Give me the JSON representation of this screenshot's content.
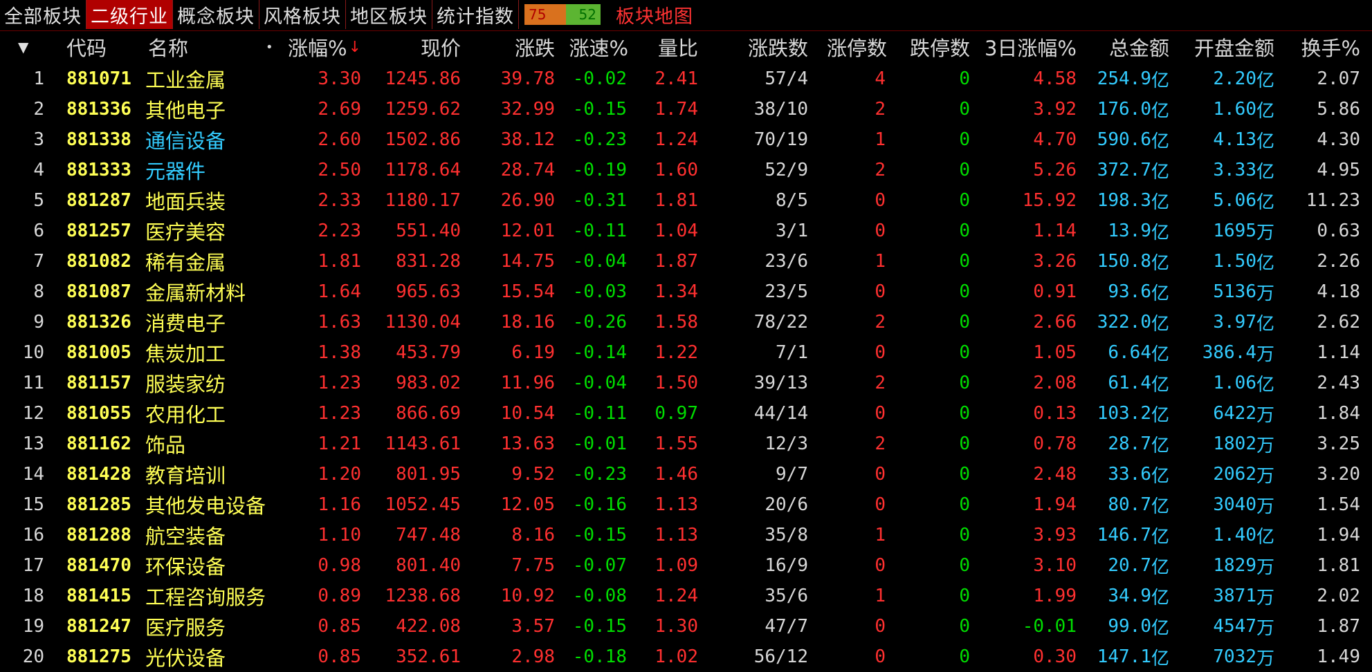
{
  "tabs": [
    {
      "label": "全部板块",
      "active": false
    },
    {
      "label": "二级行业",
      "active": true
    },
    {
      "label": "概念板块",
      "active": false
    },
    {
      "label": "风格板块",
      "active": false
    },
    {
      "label": "地区板块",
      "active": false
    },
    {
      "label": "统计指数",
      "active": false
    }
  ],
  "ratio": {
    "up": "75",
    "down": "52"
  },
  "map_link": "板块地图",
  "header": {
    "dropdown_icon": "▼",
    "code": "代码",
    "name": "名称",
    "name_dot": "•",
    "pct": "涨幅%",
    "price": "现价",
    "change": "涨跌",
    "speed": "涨速%",
    "volume_ratio": "量比",
    "up_down": "涨跌数",
    "limit_up": "涨停数",
    "limit_down": "跌停数",
    "pct_3d": "3日涨幅%",
    "total_amount": "总金额",
    "open_amount": "开盘金额",
    "turnover": "换手%"
  },
  "colors": {
    "up": "#ff3030",
    "down": "#00dd00",
    "code": "#ffff55",
    "amount": "#33ccff",
    "active_tab": "#b00000"
  },
  "rows": [
    {
      "n": "1",
      "code": "881071",
      "name": "工业金属",
      "name_blue": false,
      "pct": "3.30",
      "price": "1245.86",
      "chg": "39.78",
      "speed": "-0.02",
      "vr": "2.41",
      "vr_down": false,
      "ud": "57/4",
      "lu": "4",
      "ld": "0",
      "d3": "4.58",
      "d3_down": false,
      "tot": "254.9",
      "tot_u": "亿",
      "open": "2.20",
      "open_u": "亿",
      "turn": "2.07"
    },
    {
      "n": "2",
      "code": "881336",
      "name": "其他电子",
      "name_blue": false,
      "pct": "2.69",
      "price": "1259.62",
      "chg": "32.99",
      "speed": "-0.15",
      "vr": "1.74",
      "vr_down": false,
      "ud": "38/10",
      "lu": "2",
      "ld": "0",
      "d3": "3.92",
      "d3_down": false,
      "tot": "176.0",
      "tot_u": "亿",
      "open": "1.60",
      "open_u": "亿",
      "turn": "5.86"
    },
    {
      "n": "3",
      "code": "881338",
      "name": "通信设备",
      "name_blue": true,
      "pct": "2.60",
      "price": "1502.86",
      "chg": "38.12",
      "speed": "-0.23",
      "vr": "1.24",
      "vr_down": false,
      "ud": "70/19",
      "lu": "1",
      "ld": "0",
      "d3": "4.70",
      "d3_down": false,
      "tot": "590.6",
      "tot_u": "亿",
      "open": "4.13",
      "open_u": "亿",
      "turn": "4.30"
    },
    {
      "n": "4",
      "code": "881333",
      "name": "元器件",
      "name_blue": true,
      "pct": "2.50",
      "price": "1178.64",
      "chg": "28.74",
      "speed": "-0.19",
      "vr": "1.60",
      "vr_down": false,
      "ud": "52/9",
      "lu": "2",
      "ld": "0",
      "d3": "5.26",
      "d3_down": false,
      "tot": "372.7",
      "tot_u": "亿",
      "open": "3.33",
      "open_u": "亿",
      "turn": "4.95"
    },
    {
      "n": "5",
      "code": "881287",
      "name": "地面兵装",
      "name_blue": false,
      "pct": "2.33",
      "price": "1180.17",
      "chg": "26.90",
      "speed": "-0.31",
      "vr": "1.81",
      "vr_down": false,
      "ud": "8/5",
      "lu": "0",
      "ld": "0",
      "d3": "15.92",
      "d3_down": false,
      "tot": "198.3",
      "tot_u": "亿",
      "open": "5.06",
      "open_u": "亿",
      "turn": "11.23"
    },
    {
      "n": "6",
      "code": "881257",
      "name": "医疗美容",
      "name_blue": false,
      "pct": "2.23",
      "price": "551.40",
      "chg": "12.01",
      "speed": "-0.11",
      "vr": "1.04",
      "vr_down": false,
      "ud": "3/1",
      "lu": "0",
      "ld": "0",
      "d3": "1.14",
      "d3_down": false,
      "tot": "13.9",
      "tot_u": "亿",
      "open": "1695",
      "open_u": "万",
      "turn": "0.63"
    },
    {
      "n": "7",
      "code": "881082",
      "name": "稀有金属",
      "name_blue": false,
      "pct": "1.81",
      "price": "831.28",
      "chg": "14.75",
      "speed": "-0.04",
      "vr": "1.87",
      "vr_down": false,
      "ud": "23/6",
      "lu": "1",
      "ld": "0",
      "d3": "3.26",
      "d3_down": false,
      "tot": "150.8",
      "tot_u": "亿",
      "open": "1.50",
      "open_u": "亿",
      "turn": "2.26"
    },
    {
      "n": "8",
      "code": "881087",
      "name": "金属新材料",
      "name_blue": false,
      "pct": "1.64",
      "price": "965.63",
      "chg": "15.54",
      "speed": "-0.03",
      "vr": "1.34",
      "vr_down": false,
      "ud": "23/5",
      "lu": "0",
      "ld": "0",
      "d3": "0.91",
      "d3_down": false,
      "tot": "93.6",
      "tot_u": "亿",
      "open": "5136",
      "open_u": "万",
      "turn": "4.18"
    },
    {
      "n": "9",
      "code": "881326",
      "name": "消费电子",
      "name_blue": false,
      "pct": "1.63",
      "price": "1130.04",
      "chg": "18.16",
      "speed": "-0.26",
      "vr": "1.58",
      "vr_down": false,
      "ud": "78/22",
      "lu": "2",
      "ld": "0",
      "d3": "2.66",
      "d3_down": false,
      "tot": "322.0",
      "tot_u": "亿",
      "open": "3.97",
      "open_u": "亿",
      "turn": "2.62"
    },
    {
      "n": "10",
      "code": "881005",
      "name": "焦炭加工",
      "name_blue": false,
      "pct": "1.38",
      "price": "453.79",
      "chg": "6.19",
      "speed": "-0.14",
      "vr": "1.22",
      "vr_down": false,
      "ud": "7/1",
      "lu": "0",
      "ld": "0",
      "d3": "1.05",
      "d3_down": false,
      "tot": "6.64",
      "tot_u": "亿",
      "open": "386.4",
      "open_u": "万",
      "turn": "1.14"
    },
    {
      "n": "11",
      "code": "881157",
      "name": "服装家纺",
      "name_blue": false,
      "pct": "1.23",
      "price": "983.02",
      "chg": "11.96",
      "speed": "-0.04",
      "vr": "1.50",
      "vr_down": false,
      "ud": "39/13",
      "lu": "2",
      "ld": "0",
      "d3": "2.08",
      "d3_down": false,
      "tot": "61.4",
      "tot_u": "亿",
      "open": "1.06",
      "open_u": "亿",
      "turn": "2.43"
    },
    {
      "n": "12",
      "code": "881055",
      "name": "农用化工",
      "name_blue": false,
      "pct": "1.23",
      "price": "866.69",
      "chg": "10.54",
      "speed": "-0.11",
      "vr": "0.97",
      "vr_down": true,
      "ud": "44/14",
      "lu": "0",
      "ld": "0",
      "d3": "0.13",
      "d3_down": false,
      "tot": "103.2",
      "tot_u": "亿",
      "open": "6422",
      "open_u": "万",
      "turn": "1.84"
    },
    {
      "n": "13",
      "code": "881162",
      "name": "饰品",
      "name_blue": false,
      "pct": "1.21",
      "price": "1143.61",
      "chg": "13.63",
      "speed": "-0.01",
      "vr": "1.55",
      "vr_down": false,
      "ud": "12/3",
      "lu": "2",
      "ld": "0",
      "d3": "0.78",
      "d3_down": false,
      "tot": "28.7",
      "tot_u": "亿",
      "open": "1802",
      "open_u": "万",
      "turn": "3.25"
    },
    {
      "n": "14",
      "code": "881428",
      "name": "教育培训",
      "name_blue": false,
      "pct": "1.20",
      "price": "801.95",
      "chg": "9.52",
      "speed": "-0.23",
      "vr": "1.46",
      "vr_down": false,
      "ud": "9/7",
      "lu": "0",
      "ld": "0",
      "d3": "2.48",
      "d3_down": false,
      "tot": "33.6",
      "tot_u": "亿",
      "open": "2062",
      "open_u": "万",
      "turn": "3.20"
    },
    {
      "n": "15",
      "code": "881285",
      "name": "其他发电设备",
      "name_blue": false,
      "pct": "1.16",
      "price": "1052.45",
      "chg": "12.05",
      "speed": "-0.16",
      "vr": "1.13",
      "vr_down": false,
      "ud": "20/6",
      "lu": "0",
      "ld": "0",
      "d3": "1.94",
      "d3_down": false,
      "tot": "80.7",
      "tot_u": "亿",
      "open": "3040",
      "open_u": "万",
      "turn": "1.54"
    },
    {
      "n": "16",
      "code": "881288",
      "name": "航空装备",
      "name_blue": false,
      "pct": "1.10",
      "price": "747.48",
      "chg": "8.16",
      "speed": "-0.15",
      "vr": "1.13",
      "vr_down": false,
      "ud": "35/8",
      "lu": "1",
      "ld": "0",
      "d3": "3.93",
      "d3_down": false,
      "tot": "146.7",
      "tot_u": "亿",
      "open": "1.40",
      "open_u": "亿",
      "turn": "1.94"
    },
    {
      "n": "17",
      "code": "881470",
      "name": "环保设备",
      "name_blue": false,
      "pct": "0.98",
      "price": "801.40",
      "chg": "7.75",
      "speed": "-0.07",
      "vr": "1.09",
      "vr_down": false,
      "ud": "16/9",
      "lu": "0",
      "ld": "0",
      "d3": "3.10",
      "d3_down": false,
      "tot": "20.7",
      "tot_u": "亿",
      "open": "1829",
      "open_u": "万",
      "turn": "1.81"
    },
    {
      "n": "18",
      "code": "881415",
      "name": "工程咨询服务",
      "name_blue": false,
      "pct": "0.89",
      "price": "1238.68",
      "chg": "10.92",
      "speed": "-0.08",
      "vr": "1.24",
      "vr_down": false,
      "ud": "35/6",
      "lu": "1",
      "ld": "0",
      "d3": "1.99",
      "d3_down": false,
      "tot": "34.9",
      "tot_u": "亿",
      "open": "3871",
      "open_u": "万",
      "turn": "2.02"
    },
    {
      "n": "19",
      "code": "881247",
      "name": "医疗服务",
      "name_blue": false,
      "pct": "0.85",
      "price": "422.08",
      "chg": "3.57",
      "speed": "-0.15",
      "vr": "1.30",
      "vr_down": false,
      "ud": "47/7",
      "lu": "0",
      "ld": "0",
      "d3": "-0.01",
      "d3_down": true,
      "tot": "99.0",
      "tot_u": "亿",
      "open": "4547",
      "open_u": "万",
      "turn": "1.87"
    },
    {
      "n": "20",
      "code": "881275",
      "name": "光伏设备",
      "name_blue": false,
      "pct": "0.85",
      "price": "352.61",
      "chg": "2.98",
      "speed": "-0.18",
      "vr": "1.02",
      "vr_down": false,
      "ud": "56/12",
      "lu": "0",
      "ld": "0",
      "d3": "0.30",
      "d3_down": false,
      "tot": "147.1",
      "tot_u": "亿",
      "open": "7032",
      "open_u": "万",
      "turn": "1.49"
    }
  ]
}
